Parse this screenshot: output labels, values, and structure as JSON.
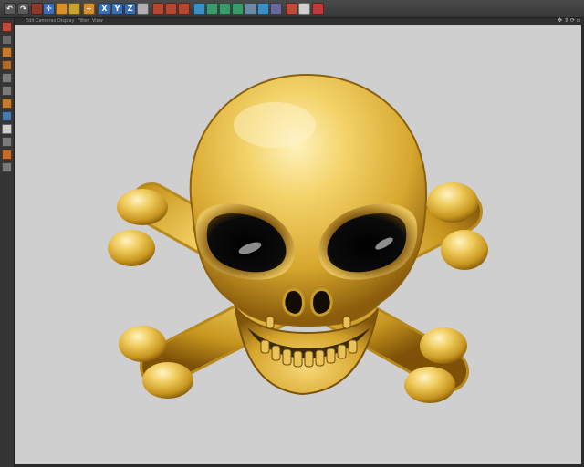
{
  "colors": {
    "ui_dark": "#2e2e2e",
    "viewport_bg": "#cfcfcf",
    "gold_light": "#ffe9a3",
    "gold_mid": "#e0b640",
    "gold_dark": "#8a5e10",
    "eye_socket": "#050505"
  },
  "menu": {
    "edit": "Edit",
    "cameras": "Cameras",
    "display": "Display",
    "filter": "Filter",
    "view": "View"
  },
  "toolbar_icons": [
    "undo-icon",
    "redo-icon",
    "live-selection-icon",
    "move-icon",
    "scale-icon",
    "rotate-icon",
    "add-object-icon",
    "x-axis-icon",
    "y-axis-icon",
    "z-axis-icon",
    "coordinate-system-icon",
    "render-view-icon",
    "render-picture-viewer-icon",
    "render-settings-icon",
    "cube-icon",
    "spline-pen-icon",
    "subdivision-icon",
    "array-icon",
    "deformer-icon",
    "floor-icon",
    "camera-icon",
    "light-icon",
    "material-icon",
    "tag-icon"
  ],
  "left_palette_icons": [
    "make-editable-icon",
    "model-mode-icon",
    "texture-mode-icon",
    "workplane-icon",
    "points-mode-icon",
    "edges-mode-icon",
    "polygons-mode-icon",
    "enable-axis-icon",
    "tweak-mode-icon",
    "snap-icon",
    "solo-icon",
    "quantize-icon"
  ],
  "nav_icons": [
    "pan-view-icon",
    "zoom-view-icon",
    "rotate-view-icon",
    "toggle-view-icon"
  ]
}
